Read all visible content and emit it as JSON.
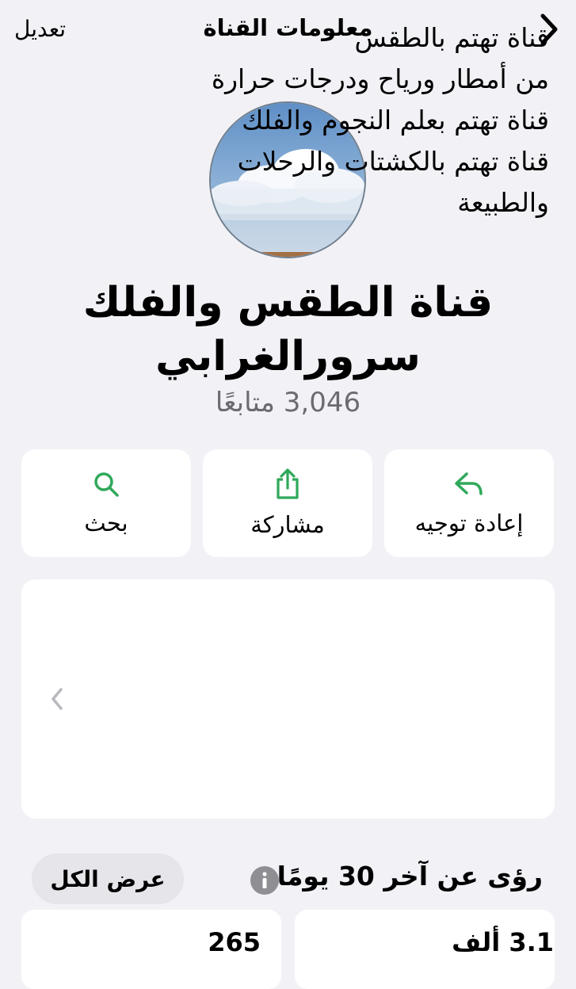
{
  "header": {
    "title": "معلومات القناة",
    "edit_label": "تعديل",
    "back_icon": "chevron-right-icon"
  },
  "channel": {
    "name_line1": "قناة الطقس والفلك",
    "name_line2": "سرورالغرابي",
    "followers": "3,046 متابعًا"
  },
  "actions": {
    "forward": {
      "label": "إعادة توجيه",
      "icon": "forward-arrow-icon"
    },
    "share": {
      "label": "مشاركة",
      "icon": "share-icon"
    },
    "search": {
      "label": "بحث",
      "icon": "search-icon"
    }
  },
  "description": {
    "text": "قناة تهتم بالطقس\nمن أمطار ورياح ودرجات حرارة\nقناة تهتم بعلم النجوم والفلك\nقناة تهتم بالكشتات والرحلات\nوالطبيعة"
  },
  "insights": {
    "title": "رؤى عن آخر 30 يومًا",
    "view_all": "عرض الكل",
    "stat_right": "3.1 ألف",
    "stat_left": "265"
  },
  "colors": {
    "accent_green": "#2fa85a",
    "background": "#f2f1f6",
    "card": "#ffffff",
    "secondary_text": "#6b6b70"
  }
}
